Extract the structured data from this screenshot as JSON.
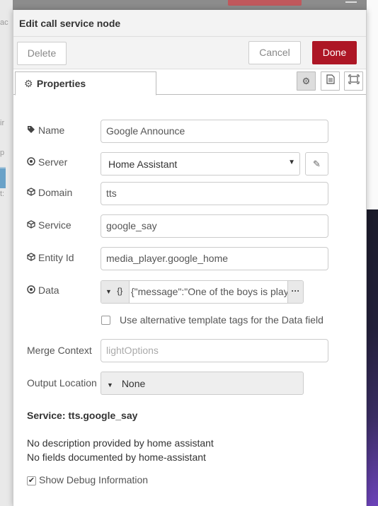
{
  "background": {
    "left_fragments": [
      "ac",
      "ir",
      "p",
      "t:"
    ]
  },
  "tray": {
    "title": "Edit call service node",
    "buttons": {
      "delete": "Delete",
      "cancel": "Cancel",
      "done": "Done"
    },
    "tab": {
      "label": "Properties",
      "icon": "gear-icon"
    },
    "tab_icons": [
      "gear-icon",
      "document-icon",
      "frame-icon"
    ]
  },
  "form": {
    "name": {
      "label": "Name",
      "icon": "tag-icon",
      "value": "Google Announce"
    },
    "server": {
      "label": "Server",
      "icon": "dot-circle-icon",
      "value": "Home Assistant"
    },
    "domain": {
      "label": "Domain",
      "icon": "cube-icon",
      "value": "tts"
    },
    "service": {
      "label": "Service",
      "icon": "cube-icon",
      "value": "google_say"
    },
    "entity_id": {
      "label": "Entity Id",
      "icon": "cube-icon",
      "value": "media_player.google_home"
    },
    "data": {
      "label": "Data",
      "icon": "dot-circle-icon",
      "type": "{}",
      "value": "{\"message\":\"One of the boys is play"
    },
    "alt_tags": {
      "label": "Use alternative template tags for the Data field",
      "checked": false
    },
    "merge_context": {
      "label": "Merge Context",
      "placeholder": "lightOptions"
    },
    "output_location": {
      "label": "Output Location",
      "value": "None"
    }
  },
  "service_info": {
    "title": "Service: tts.google_say",
    "line1": "No description provided by home assistant",
    "line2": "No fields documented by home-assistant"
  },
  "debug": {
    "label": "Show Debug Information",
    "checked": true
  },
  "colors": {
    "done": "#ad1625",
    "page_bg": "#f3f3f3"
  }
}
